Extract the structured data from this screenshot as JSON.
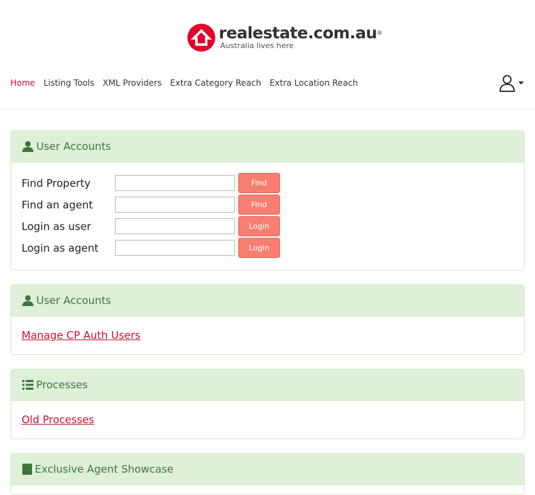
{
  "brand": {
    "name": "realestate.com.au",
    "registered": "®",
    "tagline": "Australia lives here",
    "color": "#e4002b"
  },
  "nav": {
    "items": [
      {
        "label": "Home",
        "active": true
      },
      {
        "label": "Listing Tools"
      },
      {
        "label": "XML Providers"
      },
      {
        "label": "Extra Category Reach"
      },
      {
        "label": "Extra Location Reach"
      }
    ],
    "user_icon": "user-outline-icon"
  },
  "panels": [
    {
      "title": "User Accounts",
      "icon": "user-icon",
      "rows": [
        {
          "label": "Find Property",
          "input_value": "",
          "button": "Find"
        },
        {
          "label": "Find an agent",
          "input_value": "",
          "button": "Find"
        },
        {
          "label": "Login as user",
          "input_value": "",
          "button": "Login"
        },
        {
          "label": "Login as agent",
          "input_value": "",
          "button": "Login"
        }
      ]
    },
    {
      "title": "User Accounts",
      "icon": "user-icon",
      "link": "Manage CP Auth Users"
    },
    {
      "title": "Processes",
      "icon": "list-icon",
      "link": "Old Processes"
    },
    {
      "title": "Exclusive Agent Showcase",
      "icon": "book-icon"
    }
  ],
  "colors": {
    "panel_heading_bg": "#dff0d8",
    "panel_heading_text": "#3c763d",
    "button_bg": "#f87f6f",
    "link": "#c4112f"
  }
}
